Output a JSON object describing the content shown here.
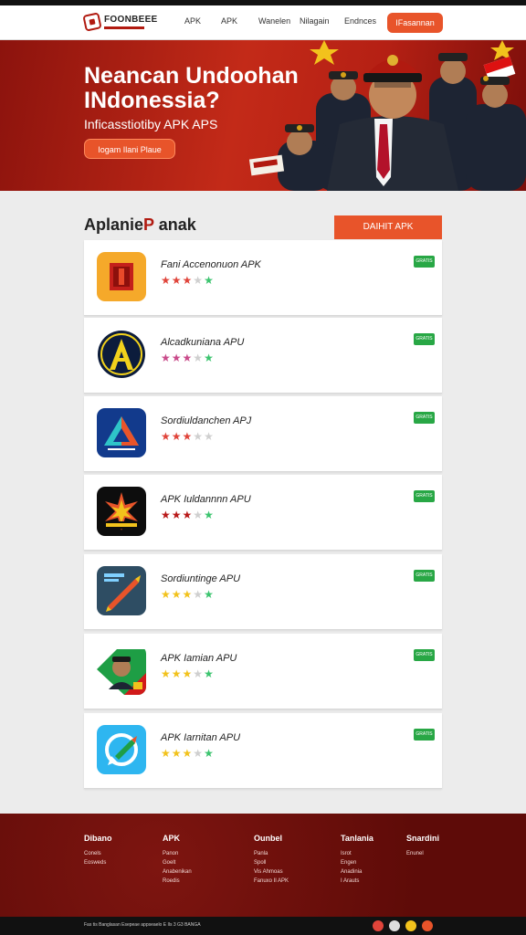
{
  "header": {
    "logo_text": "FOONBEEE",
    "nav": [
      "APK",
      "APK",
      "Wanelen",
      "Nilagain",
      "Endnces"
    ],
    "cta_label": "IFasannan"
  },
  "hero": {
    "title": "Neancan Undoohan INdonessia?",
    "subtitle": "Inficasstiotiby APK APS",
    "button_label": "Iogam Ilani Plaue"
  },
  "section": {
    "title_main": "Aplanie",
    "title_accent": "P",
    "title_rest": " anak",
    "button_label": "DAIHIT APK"
  },
  "apps": [
    {
      "name": "Fani Accenonuon APK",
      "stars": [
        "#e0443a",
        "#e0443a",
        "#e0443a",
        "#cfcfcf",
        "#3cc46f"
      ],
      "badge": "GRATIS"
    },
    {
      "name": "Alcadkuniana APU",
      "stars": [
        "#c94a8a",
        "#c94a8a",
        "#c94a8a",
        "#cfcfcf",
        "#3cc46f"
      ],
      "badge": "GRATIS"
    },
    {
      "name": "Sordiuldanchen APJ",
      "stars": [
        "#e0443a",
        "#e0443a",
        "#e0443a",
        "#cfcfcf",
        "#cfcfcf"
      ],
      "badge": "GRATIS"
    },
    {
      "name": "APK Iuldannnn APU",
      "stars": [
        "#b81818",
        "#b81818",
        "#b81818",
        "#cfcfcf",
        "#3cc46f"
      ],
      "badge": "GRATIS"
    },
    {
      "name": "Sordiuntinge APU",
      "stars": [
        "#f2c21c",
        "#f2c21c",
        "#f2c21c",
        "#cfcfcf",
        "#3cc46f"
      ],
      "badge": "GRATIS"
    },
    {
      "name": "APK Iamian APU",
      "stars": [
        "#f2c21c",
        "#f2c21c",
        "#f2c21c",
        "#cfcfcf",
        "#3cc46f"
      ],
      "badge": "GRATIS"
    },
    {
      "name": "APK Iarnitan APU",
      "stars": [
        "#f2c21c",
        "#f2c21c",
        "#f2c21c",
        "#cfcfcf",
        "#3cc46f"
      ],
      "badge": "GRATIS"
    }
  ],
  "star_glyph": "★",
  "footer": {
    "columns": [
      {
        "title": "Dibano",
        "links": [
          "Conels",
          "Eosweds"
        ]
      },
      {
        "title": "APK",
        "links": [
          "Panon",
          "Goelt",
          "Anabenikan",
          "Roedis"
        ]
      },
      {
        "title": "Ounbel",
        "links": [
          "Panla",
          "Spoll",
          "Vis Ahmoas",
          "Fanuxo Il APK"
        ]
      },
      {
        "title": "Tanlania",
        "links": [
          "Isrot",
          "Engen",
          "Anadinia",
          "I Arauts"
        ]
      },
      {
        "title": "Snardini",
        "links": [
          "Enunel"
        ]
      }
    ],
    "copyright": "Fas tis Banglasan Esepeae appseaelo E Ils 3 G3 BANGA",
    "social_colors": [
      "#e0443a",
      "#dddddd",
      "#f2c21c",
      "#e8542a"
    ]
  }
}
